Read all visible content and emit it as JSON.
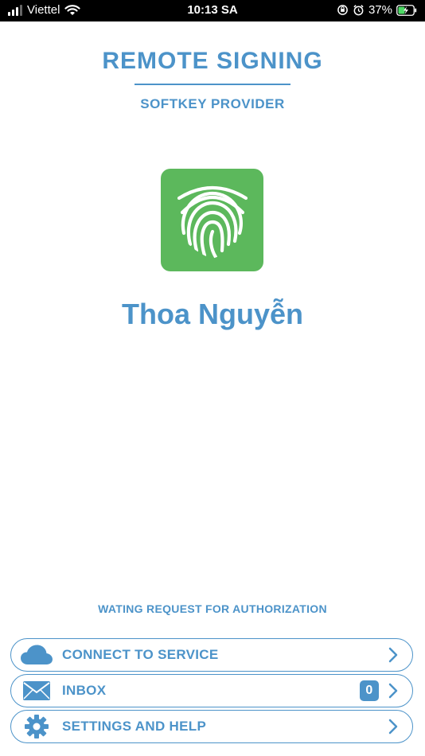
{
  "status_bar": {
    "carrier": "Viettel",
    "time": "10:13 SA",
    "battery": "37%"
  },
  "header": {
    "title": "REMOTE SIGNING",
    "subtitle": "SOFTKEY PROVIDER"
  },
  "logo": {
    "icon": "fingerprint-icon",
    "background_color": "#5cb85c"
  },
  "user": {
    "name": "Thoa Nguyễn"
  },
  "status": {
    "message": "WATING REQUEST FOR AUTHORIZATION"
  },
  "menu": {
    "items": [
      {
        "label": "CONNECT TO SERVICE",
        "icon": "cloud-icon"
      },
      {
        "label": "INBOX",
        "icon": "mail-icon",
        "badge": "0"
      },
      {
        "label": "SETTINGS AND HELP",
        "icon": "gear-icon"
      }
    ]
  },
  "colors": {
    "accent": "#4c93c9",
    "logo_green": "#5cb85c"
  }
}
